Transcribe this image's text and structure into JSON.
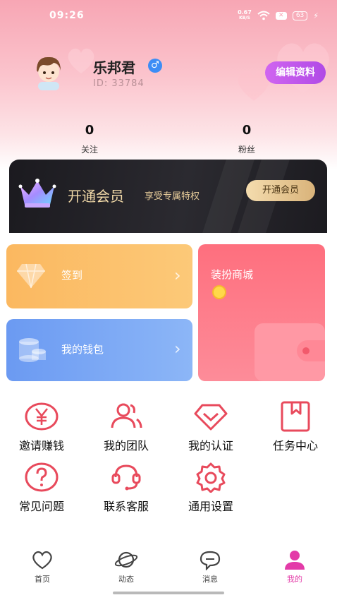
{
  "status_bar": {
    "time": "09:26",
    "speed_value": "0.67",
    "speed_unit": "KB/S",
    "battery": "63"
  },
  "profile": {
    "name": "乐邦君",
    "gender_symbol": "♂",
    "id_text": "ID: 33784",
    "edit_label": "编辑资料"
  },
  "stats": {
    "following_count": "0",
    "following_label": "关注",
    "fans_count": "0",
    "fans_label": "粉丝"
  },
  "vip": {
    "title": "开通会员",
    "subtitle": "享受专属特权",
    "button_label": "开通会员"
  },
  "cards": {
    "signin_label": "签到",
    "wallet_label": "我的钱包",
    "shop_label": "装扮商城"
  },
  "grid": {
    "items": [
      {
        "label": "邀请赚钱",
        "icon": "yen-icon"
      },
      {
        "label": "我的团队",
        "icon": "team-icon"
      },
      {
        "label": "我的认证",
        "icon": "certify-icon"
      },
      {
        "label": "任务中心",
        "icon": "task-icon"
      },
      {
        "label": "常见问题",
        "icon": "question-icon"
      },
      {
        "label": "联系客服",
        "icon": "headset-icon"
      },
      {
        "label": "通用设置",
        "icon": "gear-icon"
      }
    ]
  },
  "tabs": [
    {
      "label": "首页",
      "icon": "home-heart-icon"
    },
    {
      "label": "动态",
      "icon": "planet-icon"
    },
    {
      "label": "消息",
      "icon": "chat-icon"
    },
    {
      "label": "我的",
      "icon": "person-icon",
      "active": true
    }
  ],
  "colors": {
    "accent_pink": "#fe6f7e",
    "edit_purple": "#c35bee",
    "icon_red": "#e84a5c",
    "active_tab": "#e33ba8"
  }
}
